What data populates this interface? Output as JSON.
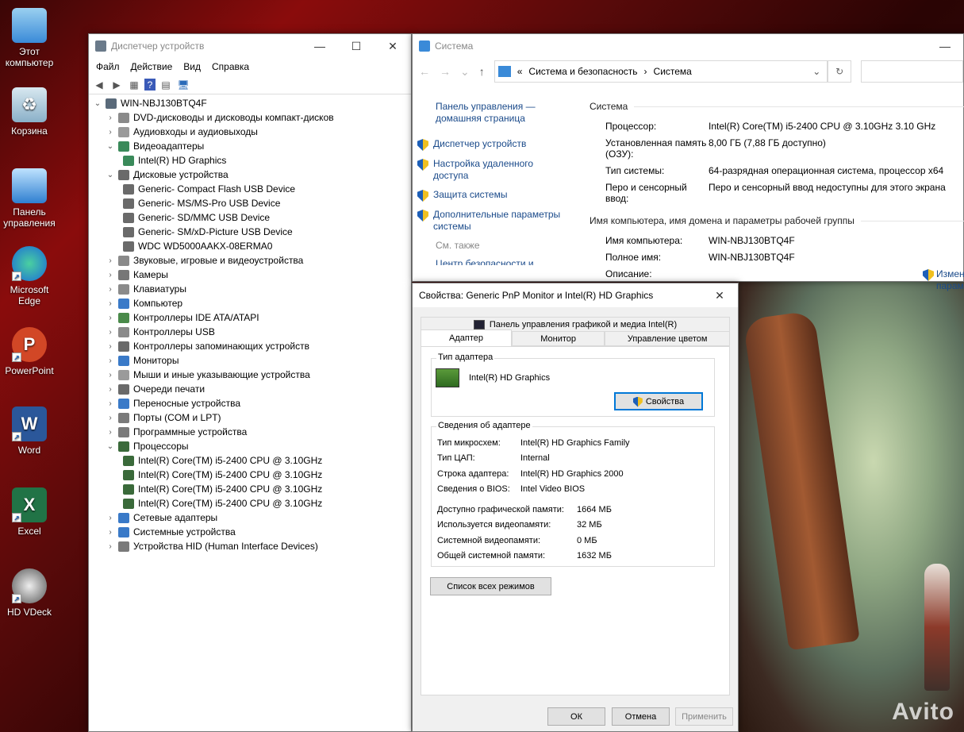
{
  "desktop": {
    "icons": [
      {
        "label": "Этот компьютер",
        "icon": "computer-icon"
      },
      {
        "label": "Корзина",
        "icon": "recycle-bin-icon"
      },
      {
        "label": "Панель управления",
        "icon": "control-panel-icon"
      },
      {
        "label": "Microsoft Edge",
        "icon": "edge-icon"
      },
      {
        "label": "PowerPoint",
        "icon": "powerpoint-icon"
      },
      {
        "label": "Word",
        "icon": "word-icon"
      },
      {
        "label": "Excel",
        "icon": "excel-icon"
      },
      {
        "label": "HD VDeck",
        "icon": "hd-vdeck-icon"
      }
    ],
    "watermark": "Avito"
  },
  "device_manager": {
    "title": "Диспетчер устройств",
    "menu": [
      "Файл",
      "Действие",
      "Вид",
      "Справка"
    ],
    "root": "WIN-NBJ130BTQ4F",
    "tree": [
      {
        "label": "DVD-дисководы и дисководы компакт-дисков",
        "level": 1,
        "expanded": false,
        "color": "#8a8a8a"
      },
      {
        "label": "Аудиовходы и аудиовыходы",
        "level": 1,
        "expanded": false,
        "color": "#9a9a9a"
      },
      {
        "label": "Видеоадаптеры",
        "level": 1,
        "expanded": true,
        "color": "#3a8a5a"
      },
      {
        "label": "Intel(R) HD Graphics",
        "level": 2,
        "color": "#3a8a5a"
      },
      {
        "label": "Дисковые устройства",
        "level": 1,
        "expanded": true,
        "color": "#6a6a6a"
      },
      {
        "label": "Generic- Compact Flash USB Device",
        "level": 2,
        "color": "#6a6a6a"
      },
      {
        "label": "Generic- MS/MS-Pro USB Device",
        "level": 2,
        "color": "#6a6a6a"
      },
      {
        "label": "Generic- SD/MMC USB Device",
        "level": 2,
        "color": "#6a6a6a"
      },
      {
        "label": "Generic- SM/xD-Picture USB Device",
        "level": 2,
        "color": "#6a6a6a"
      },
      {
        "label": "WDC WD5000AAKX-08ERMA0",
        "level": 2,
        "color": "#6a6a6a"
      },
      {
        "label": "Звуковые, игровые и видеоустройства",
        "level": 1,
        "expanded": false,
        "color": "#8a8a8a"
      },
      {
        "label": "Камеры",
        "level": 1,
        "expanded": false,
        "color": "#777777"
      },
      {
        "label": "Клавиатуры",
        "level": 1,
        "expanded": false,
        "color": "#8a8a8a"
      },
      {
        "label": "Компьютер",
        "level": 1,
        "expanded": false,
        "color": "#3a7ac8"
      },
      {
        "label": "Контроллеры IDE ATA/ATAPI",
        "level": 1,
        "expanded": false,
        "color": "#4a8a4a"
      },
      {
        "label": "Контроллеры USB",
        "level": 1,
        "expanded": false,
        "color": "#8a8a8a"
      },
      {
        "label": "Контроллеры запоминающих устройств",
        "level": 1,
        "expanded": false,
        "color": "#6a6a6a"
      },
      {
        "label": "Мониторы",
        "level": 1,
        "expanded": false,
        "color": "#3a7ac8"
      },
      {
        "label": "Мыши и иные указывающие устройства",
        "level": 1,
        "expanded": false,
        "color": "#9a9a9a"
      },
      {
        "label": "Очереди печати",
        "level": 1,
        "expanded": false,
        "color": "#6a6a6a"
      },
      {
        "label": "Переносные устройства",
        "level": 1,
        "expanded": false,
        "color": "#3a7ac8"
      },
      {
        "label": "Порты (COM и LPT)",
        "level": 1,
        "expanded": false,
        "color": "#7a7a7a"
      },
      {
        "label": "Программные устройства",
        "level": 1,
        "expanded": false,
        "color": "#7a7a7a"
      },
      {
        "label": "Процессоры",
        "level": 1,
        "expanded": true,
        "color": "#3a6a3a"
      },
      {
        "label": "Intel(R) Core(TM) i5-2400 CPU @ 3.10GHz",
        "level": 2,
        "color": "#3a6a3a"
      },
      {
        "label": "Intel(R) Core(TM) i5-2400 CPU @ 3.10GHz",
        "level": 2,
        "color": "#3a6a3a"
      },
      {
        "label": "Intel(R) Core(TM) i5-2400 CPU @ 3.10GHz",
        "level": 2,
        "color": "#3a6a3a"
      },
      {
        "label": "Intel(R) Core(TM) i5-2400 CPU @ 3.10GHz",
        "level": 2,
        "color": "#3a6a3a"
      },
      {
        "label": "Сетевые адаптеры",
        "level": 1,
        "expanded": false,
        "color": "#3a7ac8"
      },
      {
        "label": "Системные устройства",
        "level": 1,
        "expanded": false,
        "color": "#3a7ac8"
      },
      {
        "label": "Устройства HID (Human Interface Devices)",
        "level": 1,
        "expanded": false,
        "color": "#7a7a7a"
      }
    ]
  },
  "system_window": {
    "title": "Система",
    "breadcrumb": [
      "Система и безопасность",
      "Система"
    ],
    "left_links": {
      "home": "Панель управления — домашняя страница",
      "items": [
        "Диспетчер устройств",
        "Настройка удаленного доступа",
        "Защита системы",
        "Дополнительные параметры системы"
      ],
      "see_also": "См. также",
      "cut": "Центр безопасности и"
    },
    "system_heading": "Система",
    "system_rows": [
      {
        "k": "Процессор:",
        "v": "Intel(R) Core(TM) i5-2400 CPU @ 3.10GHz   3.10 GHz"
      },
      {
        "k": "Установленная память (ОЗУ):",
        "v": "8,00 ГБ (7,88 ГБ доступно)"
      },
      {
        "k": "Тип системы:",
        "v": "64-разрядная операционная система, процессор x64"
      },
      {
        "k": "Перо и сенсорный ввод:",
        "v": "Перо и сенсорный ввод недоступны для этого экрана"
      }
    ],
    "name_heading": "Имя компьютера, имя домена и параметры рабочей группы",
    "name_rows": [
      {
        "k": "Имя компьютера:",
        "v": "WIN-NBJ130BTQ4F"
      },
      {
        "k": "Полное имя:",
        "v": "WIN-NBJ130BTQ4F"
      },
      {
        "k": "Описание:",
        "v": ""
      }
    ],
    "change_link": [
      "Измен",
      "парам"
    ]
  },
  "properties": {
    "title": "Свойства: Generic PnP Monitor и Intel(R) HD Graphics",
    "intel_tab": "Панель управления графикой и медиа Intel(R)",
    "tabs": [
      "Адаптер",
      "Монитор",
      "Управление цветом"
    ],
    "adapter_type_label": "Тип адаптера",
    "adapter_name": "Intel(R) HD Graphics",
    "props_button": "Свойства",
    "info_label": "Сведения об адаптере",
    "info": [
      {
        "k": "Тип микросхем:",
        "v": "Intel(R) HD Graphics Family"
      },
      {
        "k": "Тип ЦАП:",
        "v": "Internal"
      },
      {
        "k": "Строка адаптера:",
        "v": "Intel(R) HD Graphics 2000"
      },
      {
        "k": "Сведения о BIOS:",
        "v": "Intel Video BIOS"
      }
    ],
    "memory": [
      {
        "k": "Доступно графической памяти:",
        "v": "1664 МБ"
      },
      {
        "k": "Используется видеопамяти:",
        "v": "32 МБ"
      },
      {
        "k": "Системной видеопамяти:",
        "v": "0 МБ"
      },
      {
        "k": "Общей системной памяти:",
        "v": "1632 МБ"
      }
    ],
    "modes_button": "Список всех режимов",
    "ok": "ОК",
    "cancel": "Отмена",
    "apply": "Применить"
  }
}
